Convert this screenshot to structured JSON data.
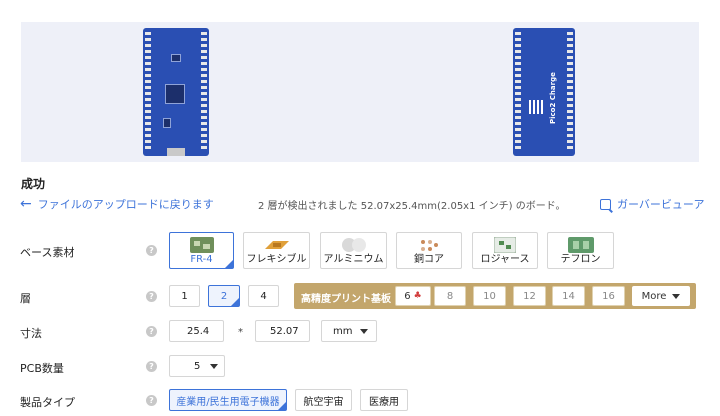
{
  "status": {
    "title": "成功"
  },
  "nav": {
    "back_label": "ファイルのアップロードに戻ります",
    "detected_text": "2 層が検出されました 52.07x25.4mm(2.05x1 インチ) のボード。",
    "viewer_label": "ガーバービューア"
  },
  "board_back_silk": "Pico2 Charge",
  "base_material": {
    "label": "ベース素材",
    "options": [
      {
        "label": "FR-4",
        "selected": true
      },
      {
        "label": "フレキシブル",
        "selected": false
      },
      {
        "label": "アルミニウム",
        "selected": false
      },
      {
        "label": "銅コア",
        "selected": false
      },
      {
        "label": "ロジャース",
        "selected": false
      },
      {
        "label": "テフロン",
        "selected": false
      }
    ]
  },
  "layers": {
    "label": "層",
    "options": [
      {
        "label": "1",
        "selected": false
      },
      {
        "label": "2",
        "selected": true
      },
      {
        "label": "4",
        "selected": false
      }
    ],
    "high_precision_label": "高精度プリント基板",
    "high_precision_options": [
      "6",
      "8",
      "10",
      "12",
      "14",
      "16"
    ],
    "more_label": "More"
  },
  "dimensions": {
    "label": "寸法",
    "width": "25.4",
    "separator": "*",
    "length": "52.07",
    "unit": "mm"
  },
  "quantity": {
    "label": "PCB数量",
    "value": "5"
  },
  "product_type": {
    "label": "製品タイプ",
    "options": [
      {
        "label": "産業用/民生用電子機器",
        "selected": true
      },
      {
        "label": "航空宇宙",
        "selected": false
      },
      {
        "label": "医療用",
        "selected": false
      }
    ]
  },
  "colors": {
    "accent": "#3d73d9",
    "board": "#2a4fb3",
    "high_precision_bar": "#c3a66c"
  }
}
